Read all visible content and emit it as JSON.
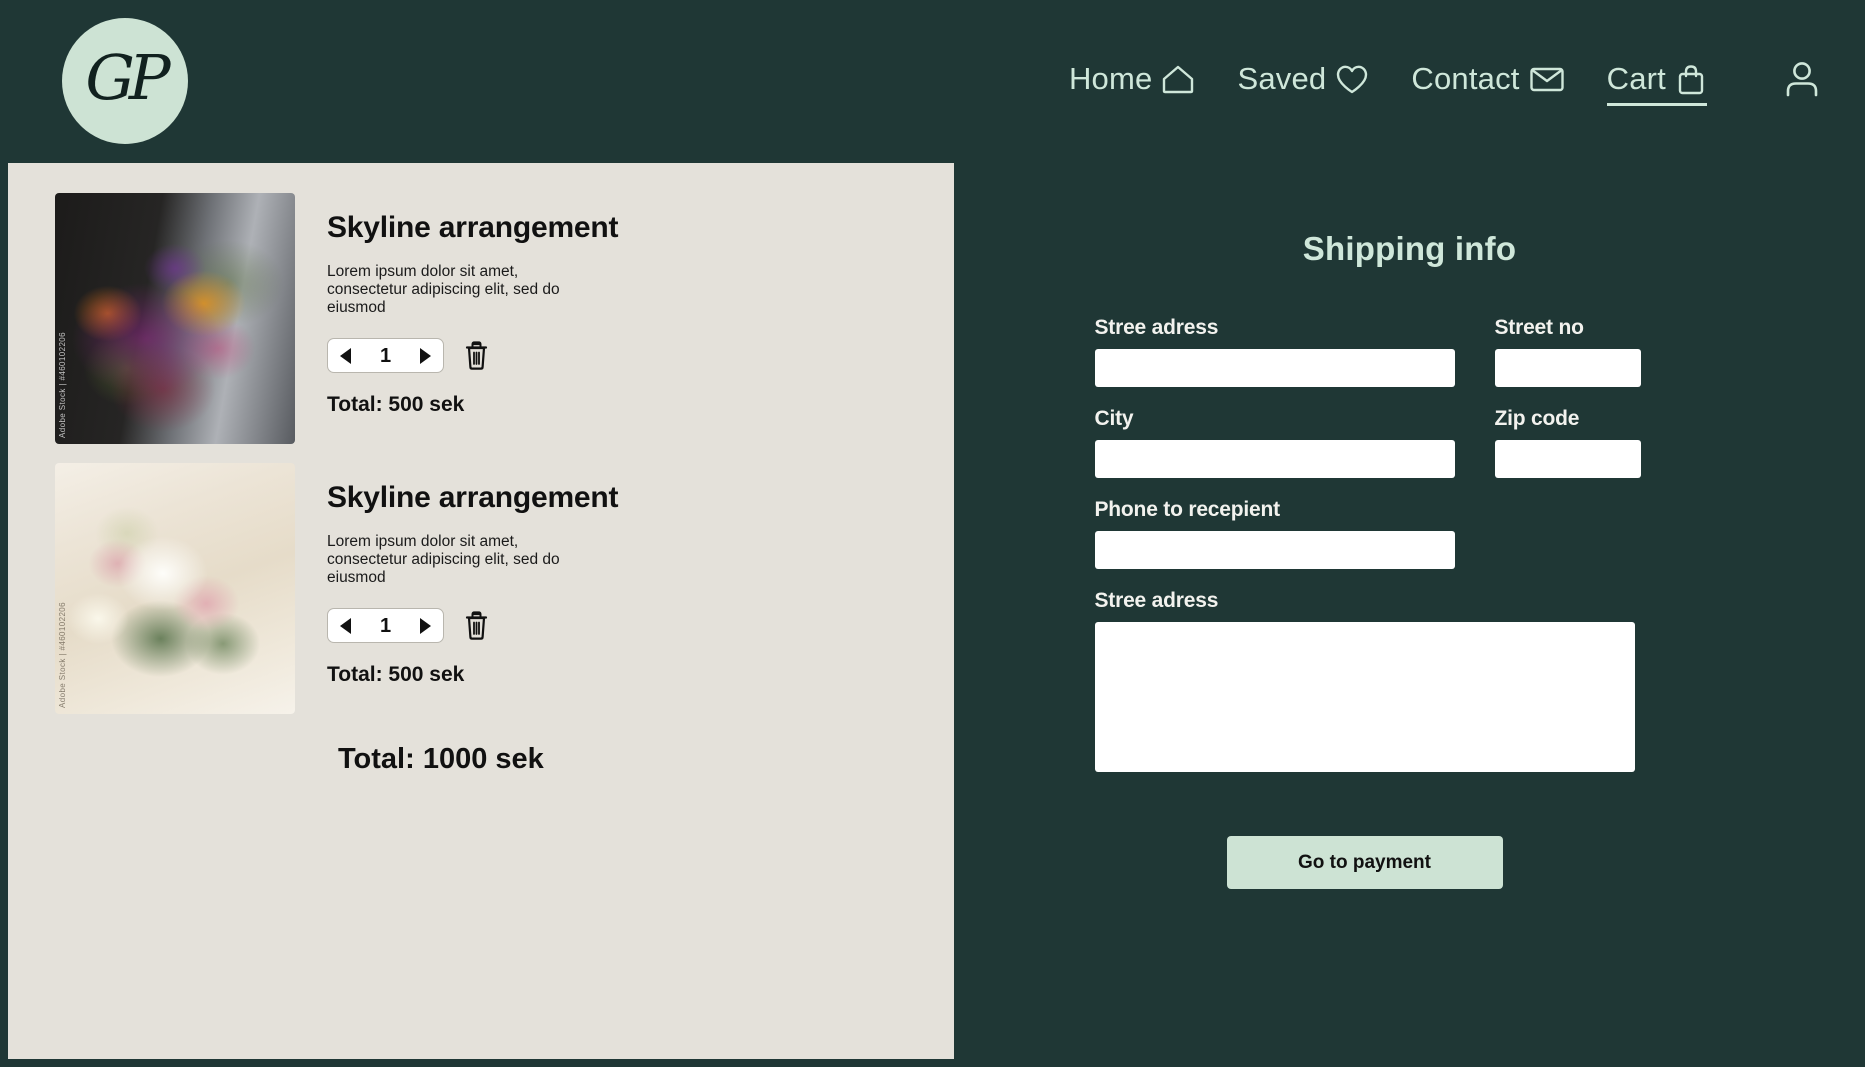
{
  "header": {
    "logo": {
      "monogram": "GP",
      "circle_color": "#cde3d4"
    },
    "nav": [
      {
        "label": "Home",
        "icon": "house-icon",
        "active": false
      },
      {
        "label": "Saved",
        "icon": "heart-icon",
        "active": false
      },
      {
        "label": "Contact",
        "icon": "envelope-icon",
        "active": false
      },
      {
        "label": "Cart",
        "icon": "shopping-bag-icon",
        "active": true
      }
    ],
    "account_icon": "user-icon",
    "background_color": "#1f3735",
    "text_color": "#cfe7da"
  },
  "cart": {
    "background_color": "#e4e1da",
    "items": [
      {
        "title": "Skyline arrangement",
        "description": "Lorem ipsum dolor sit amet, consectetur adipiscing elit, sed do eiusmod",
        "quantity": "1",
        "total": "Total: 500 sek",
        "image_watermark": "Adobe Stock | #460102206",
        "decrement_icon": "left-arrow-icon",
        "increment_icon": "right-arrow-icon",
        "delete_icon": "trash-icon"
      },
      {
        "title": "Skyline arrangement",
        "description": "Lorem ipsum dolor sit amet, consectetur adipiscing elit, sed do eiusmod",
        "quantity": "1",
        "total": "Total: 500 sek",
        "image_watermark": "Adobe Stock | #460102206",
        "decrement_icon": "left-arrow-icon",
        "increment_icon": "right-arrow-icon",
        "delete_icon": "trash-icon"
      }
    ],
    "grand_total": "Total: 1000 sek"
  },
  "shipping": {
    "title": "Shipping info",
    "background_color": "#1f3735",
    "title_color": "#cfe7da",
    "fields": {
      "street_address_label": "Stree adress",
      "street_address_value": "",
      "street_no_label": "Street no",
      "street_no_value": "",
      "city_label": "City",
      "city_value": "",
      "zip_label": "Zip code",
      "zip_value": "",
      "phone_label": "Phone to recepient",
      "phone_value": "",
      "message_label": "Stree adress",
      "message_value": ""
    },
    "submit_label": "Go to payment",
    "submit_color": "#cde3d4"
  }
}
